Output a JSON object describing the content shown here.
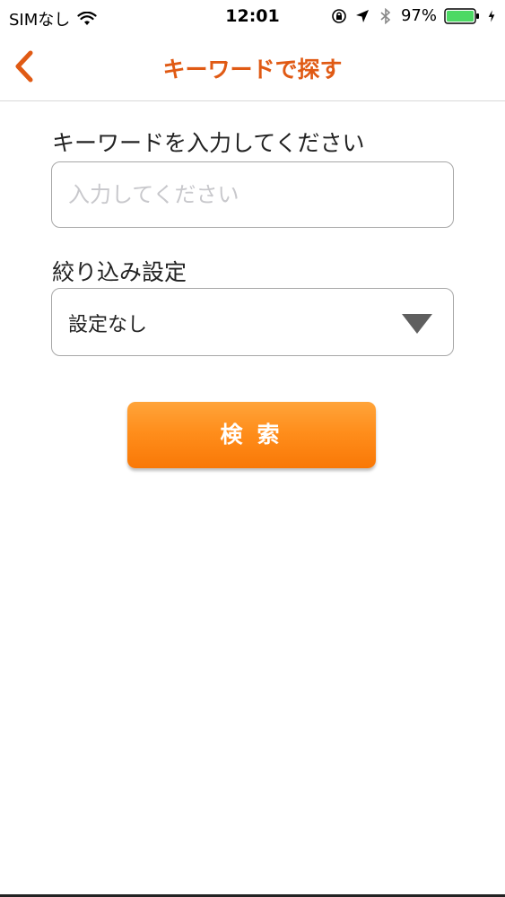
{
  "status_bar": {
    "carrier": "SIMなし",
    "time": "12:01",
    "battery": "97%",
    "icons": [
      "wifi-icon",
      "orientation-lock-icon",
      "location-arrow-icon",
      "bluetooth-icon",
      "battery-icon",
      "charging-bolt-icon"
    ]
  },
  "nav": {
    "title": "キーワードで探す",
    "back_icon": "chevron-left-icon"
  },
  "keyword": {
    "label": "キーワードを入力してください",
    "placeholder": "入力してください",
    "value": ""
  },
  "filter": {
    "label": "絞り込み設定",
    "selected": "設定なし",
    "icon": "triangle-down-icon"
  },
  "search": {
    "button_label": "検索"
  },
  "colors": {
    "accent": "#e05a14",
    "button": "#ff8e1c",
    "battery": "#4cd964"
  }
}
